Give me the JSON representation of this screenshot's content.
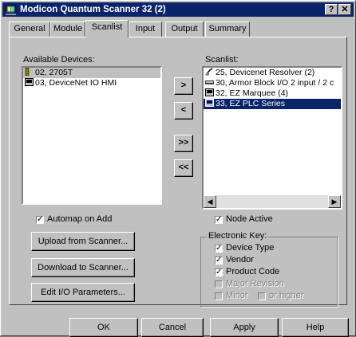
{
  "window": {
    "title": "Modicon Quantum Scanner 32 (2)",
    "help_glyph": "?",
    "close_glyph": "✕"
  },
  "tabs": [
    "General",
    "Module",
    "Scanlist",
    "Input",
    "Output",
    "Summary"
  ],
  "active_tab": "Scanlist",
  "available": {
    "label": "Available Devices:",
    "items": [
      "02, 2705T",
      "03, DeviceNet IO HMI"
    ]
  },
  "scanlist": {
    "label": "Scanlist:",
    "items": [
      "25, Devicenet Resolver (2)",
      "30, Armor Block I/O  2 input / 2 c",
      "32, EZ Marquee (4)",
      "33, EZ PLC Series"
    ]
  },
  "move_buttons": [
    ">",
    "<",
    ">>",
    "<<"
  ],
  "scrollbar": {
    "left": "◀",
    "right": "▶"
  },
  "automap": {
    "label": "Automap on Add",
    "check": "✓"
  },
  "node_active": {
    "label": "Node Active",
    "check": "✓"
  },
  "buttons": {
    "upload": "Upload from Scanner...",
    "download": "Download to Scanner...",
    "edit": "Edit I/O Parameters..."
  },
  "electronic_key": {
    "label": "Electronic Key:",
    "device_type": "Device Type",
    "vendor": "Vendor",
    "product_code": "Product Code",
    "major_revision": "Major Revision",
    "minor": "Minor",
    "or_higher": "or higher"
  },
  "footer": {
    "ok": "OK",
    "cancel": "Cancel",
    "apply": "Apply",
    "help": "Help"
  }
}
